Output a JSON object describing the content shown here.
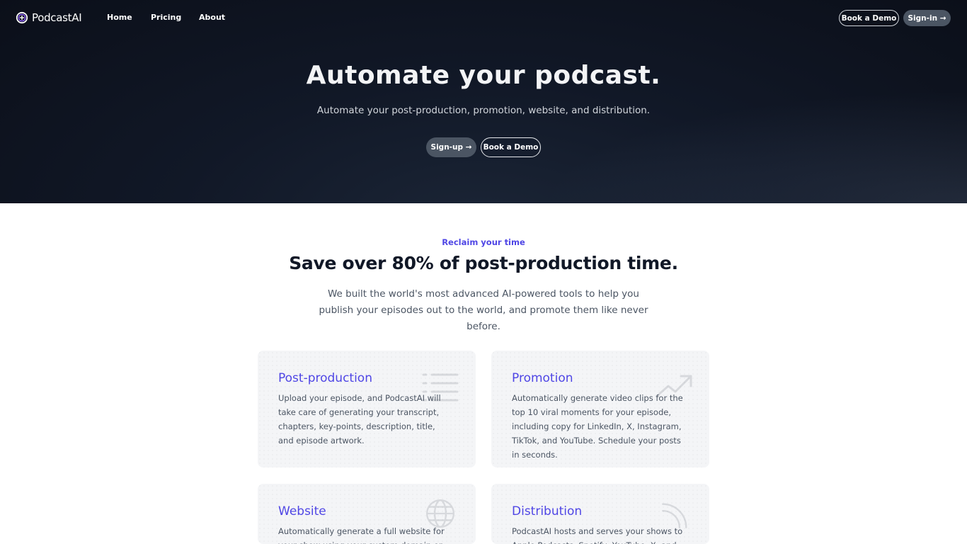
{
  "nav": {
    "brand": "PodcastAI",
    "links": [
      "Home",
      "Pricing",
      "About"
    ],
    "book_demo": "Book a Demo",
    "sign_in": "Sign-in →"
  },
  "hero": {
    "title": "Automate your podcast.",
    "subtitle": "Automate your post-production, promotion, website, and distribution.",
    "signup": "Sign-up →",
    "book_demo": "Book a Demo"
  },
  "section": {
    "eyebrow": "Reclaim your time",
    "title": "Save over 80% of post-production time.",
    "description": "We built the world's most advanced AI-powered tools to help you publish your episodes out to the world, and promote them like never before."
  },
  "cards": [
    {
      "title": "Post-production",
      "text": "Upload your episode, and PodcastAI will take care of generating your transcript, chapters, key-points, description, title, and episode artwork.",
      "icon": "list-icon"
    },
    {
      "title": "Promotion",
      "text": "Automatically generate video clips for the top 10 viral moments for your episode, including copy for LinkedIn, X, Instagram, TikTok, and YouTube. Schedule your posts in seconds.",
      "icon": "trending-up-icon"
    },
    {
      "title": "Website",
      "text": "Automatically generate a full website for your show using your custom domain or subdomain",
      "icon": "globe-icon"
    },
    {
      "title": "Distribution",
      "text": "PodcastAI hosts and serves your shows to Apple Podcasts, Spotify, YouTube, X, and any other",
      "icon": "signal-icon"
    }
  ],
  "colors": {
    "accent": "#4f46e5",
    "hero_bg": "#0b0f19",
    "card_bg": "#f3f4f6"
  }
}
